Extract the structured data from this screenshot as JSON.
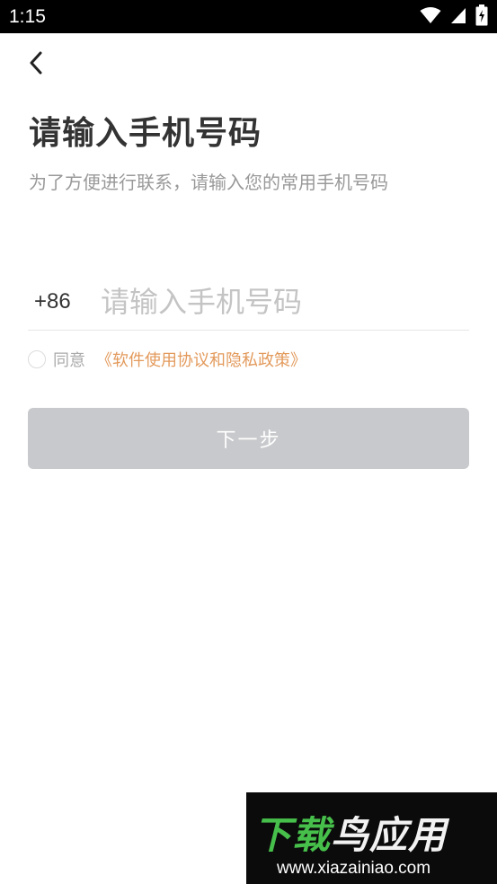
{
  "status_bar": {
    "time": "1:15",
    "icons": [
      "wifi-icon",
      "signal-icon",
      "battery-icon"
    ]
  },
  "header": {
    "back_icon": "chevron-left-icon"
  },
  "title": "请输入手机号码",
  "subtitle": "为了方便进行联系，请输入您的常用手机号码",
  "phone": {
    "country_code": "+86",
    "placeholder": "请输入手机号码",
    "value": ""
  },
  "agreement": {
    "checked": false,
    "label": "同意",
    "link_text": "《软件使用协议和隐私政策》"
  },
  "next_button": {
    "label": "下一步",
    "enabled": false
  },
  "watermark": {
    "brand_prefix": "下载",
    "brand_suffix": "鸟应用",
    "url": "www.xiazainiao.com"
  },
  "colors": {
    "status_bar_bg": "#000000",
    "title": "#333333",
    "subtitle": "#999999",
    "placeholder": "#c4c4c4",
    "link": "#e39a5c",
    "button_disabled_bg": "#c8c9cc",
    "button_text": "#ffffff"
  }
}
